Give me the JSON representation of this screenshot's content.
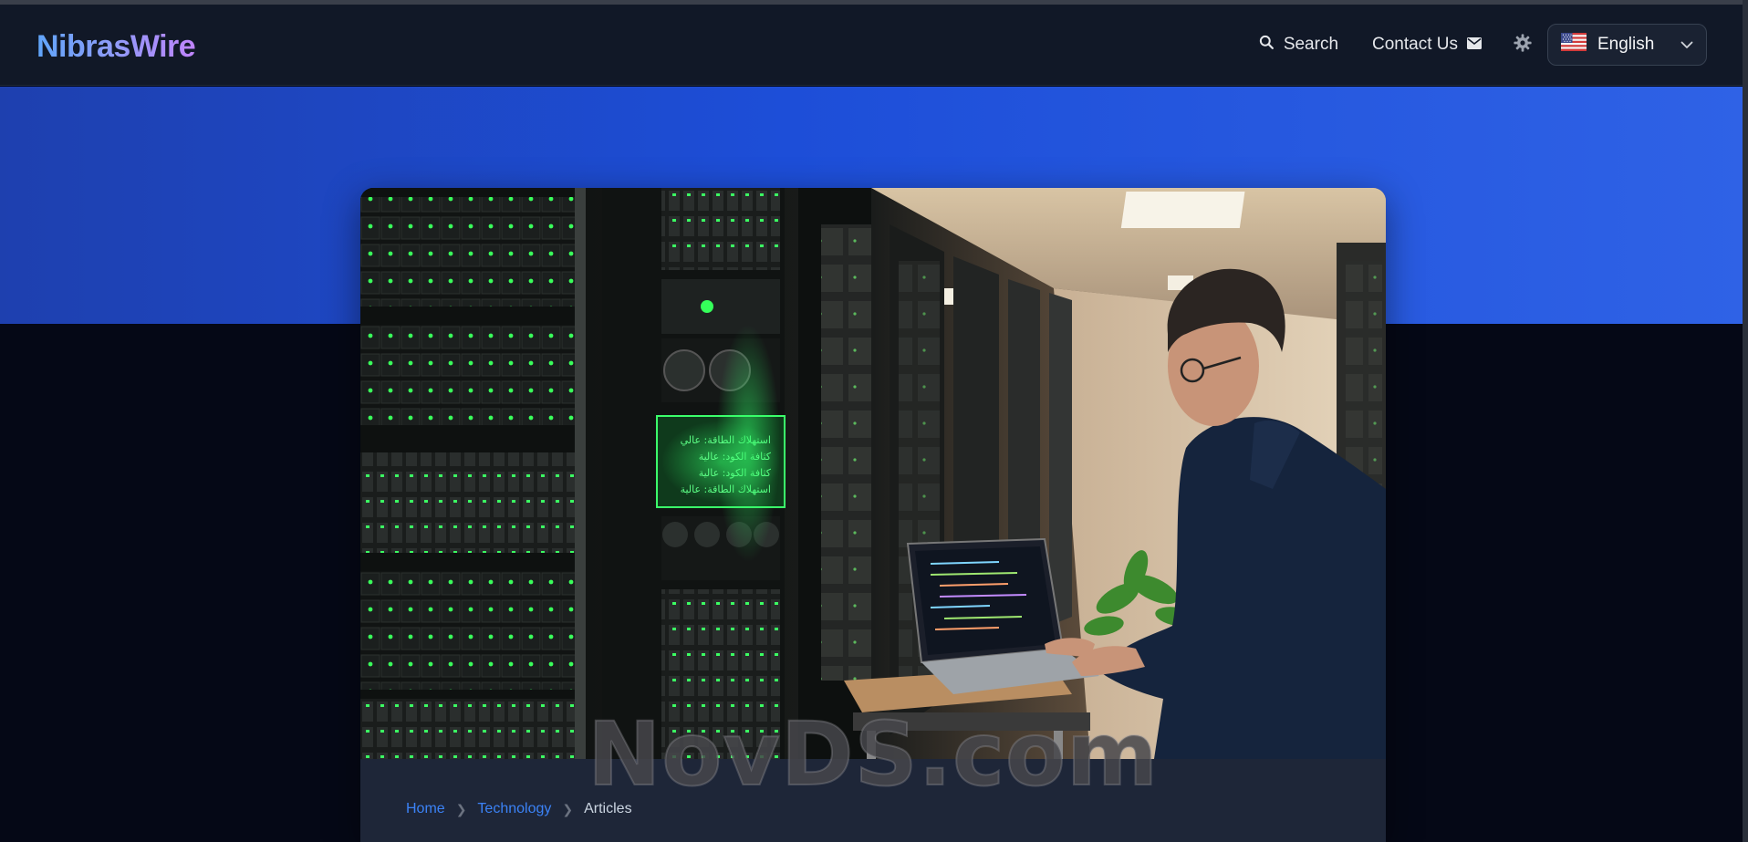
{
  "header": {
    "logo": "NibrasWire",
    "nav": {
      "search_label": "Search",
      "contact_label": "Contact Us"
    },
    "language": {
      "selected": "English",
      "flag": "us-flag-icon"
    }
  },
  "hero": {
    "band_color": "#1d4ed8",
    "image_alt": "Man using a laptop in a server room",
    "screen_text": [
      "استهلاك الطاقة: عالي",
      "كثافة الكود: عالية",
      "كثافة الكود: عالية",
      "استهلاك الطاقة: عالية"
    ]
  },
  "watermark": "NovDS.com",
  "breadcrumb": {
    "items": [
      "Home",
      "Technology",
      "Articles"
    ]
  },
  "colors": {
    "navbar": "#111827",
    "page_bg": "#050816",
    "link": "#3b82f6",
    "logo_gradient": [
      "#60a5fa",
      "#c084fc"
    ]
  }
}
